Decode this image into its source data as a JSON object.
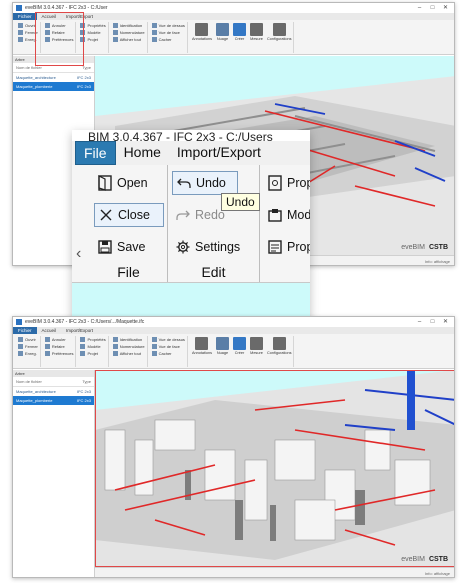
{
  "windows": {
    "top": {
      "title": "eveBIM 3.0.4.367 - IFC 2x3 - C:/User",
      "tabs": [
        "Fichier",
        "Accueil",
        "Import/Export"
      ],
      "active_tab": "Accueil"
    },
    "bottom": {
      "title": "eveBIM 3.0.4.367 - IFC 2x3 - C:/Users/.../Maquette.ifc",
      "tabs": [
        "Fichier",
        "Accueil",
        "Import/Export"
      ],
      "active_tab": "Accueil"
    }
  },
  "ribbon_small": {
    "group1": [
      "Ouvrir",
      "Fermer",
      "Enreg."
    ],
    "group2": [
      "Annuler",
      "Refaire",
      "Préférences"
    ],
    "group3": [
      "Propriétés",
      "Modèle",
      "Projet"
    ],
    "group4": [
      "Identification",
      "Nomenclature",
      "Afficher tout"
    ],
    "group5": [
      "Vue de dessus",
      "Vue de face",
      "Cacher"
    ],
    "big_buttons": [
      "Annotations",
      "Nuage",
      "Créer",
      "Mesure",
      "Configurations"
    ]
  },
  "side_panel": {
    "header": "Arbre",
    "col_name": "Nom de fichier",
    "col_type": "Type",
    "rows": [
      {
        "name": "Maquette_architecture",
        "type": "IFC 2x3",
        "selected": false
      },
      {
        "name": "Maquette_plomberie",
        "type": "IFC 2x3",
        "selected": true
      }
    ]
  },
  "brand": {
    "product": "eveBIM",
    "org": "CSTB"
  },
  "status": "Info: affichage",
  "callout": {
    "title": "BIM 3.0.4.367 - IFC 2x3 - C:/Users",
    "tabs": {
      "file": "File",
      "home": "Home",
      "import_export": "Import/Export"
    },
    "file_group": {
      "name": "File",
      "open": "Open",
      "close": "Close",
      "save": "Save"
    },
    "edit_group": {
      "name": "Edit",
      "undo": "Undo",
      "redo": "Redo",
      "settings": "Settings"
    },
    "third_group": {
      "item1": "Prop",
      "item2": "Mod",
      "item3": "Prop"
    },
    "tooltip": "Undo"
  },
  "colors": {
    "accent": "#2b7ab1",
    "highlight": "#e04848",
    "viewport_bg": "#cdfafa",
    "pipe_red": "#e02828",
    "pipe_blue": "#2040c8"
  }
}
